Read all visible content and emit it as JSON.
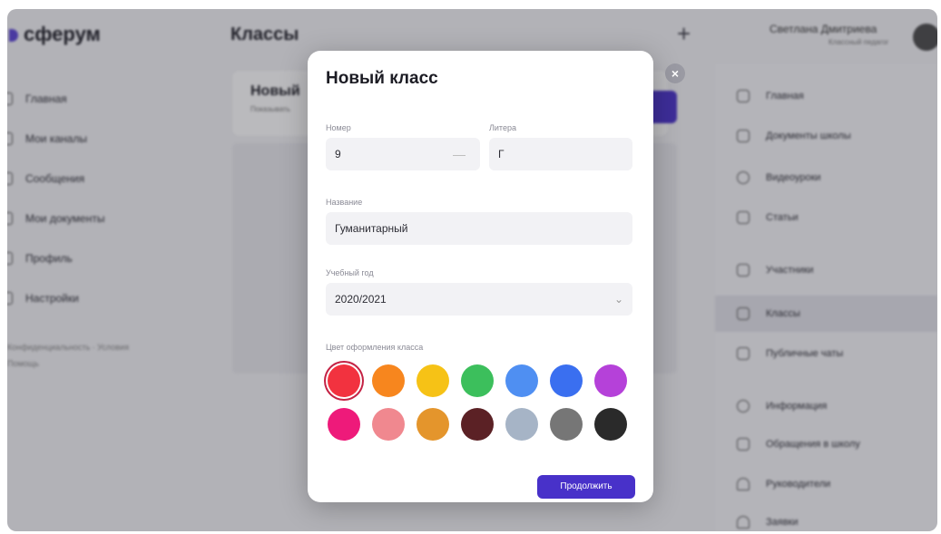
{
  "app": {
    "logo": "сферум",
    "page_title": "Классы",
    "add_icon": "plus-icon",
    "user_name": "Светлана Дмитриева",
    "user_role": "Классный педагог"
  },
  "sidebar": {
    "items": [
      {
        "label": "Главная",
        "icon": "home-icon"
      },
      {
        "label": "Мои каналы",
        "icon": "channels-icon"
      },
      {
        "label": "Сообщения",
        "icon": "chat-icon"
      },
      {
        "label": "Мои документы",
        "icon": "doc-icon"
      },
      {
        "label": "Профиль",
        "icon": "profile-icon"
      },
      {
        "label": "Настройки",
        "icon": "settings-icon"
      }
    ],
    "footer": "Конфиденциальность · Условия",
    "footer2": "Помощь"
  },
  "center": {
    "class_card_title": "Новый",
    "class_card_sub": "Показывать"
  },
  "right_panel": {
    "items": [
      {
        "label": "Главная",
        "icon": "home-icon"
      },
      {
        "label": "Документы школы",
        "icon": "document-icon"
      },
      {
        "label": "Видеоуроки",
        "icon": "play-icon"
      },
      {
        "label": "Статьи",
        "icon": "article-icon"
      },
      {
        "label": "Участники",
        "icon": "members-icon"
      },
      {
        "label": "Классы",
        "icon": "classes-icon"
      },
      {
        "label": "Публичные чаты",
        "icon": "chat-icon"
      },
      {
        "label": "Информация",
        "icon": "info-icon"
      },
      {
        "label": "Обращения в школу",
        "icon": "request-icon"
      },
      {
        "label": "Руководители",
        "icon": "leader-icon"
      },
      {
        "label": "Заявки",
        "icon": "user-add-icon"
      }
    ]
  },
  "modal": {
    "title": "Новый класс",
    "close_icon": "close-icon",
    "number_label": "Номер",
    "number_value": "9",
    "letter_label": "Литера",
    "letter_value": "Г",
    "name_label": "Название",
    "name_value": "Гуманитарный",
    "year_label": "Учебный год",
    "year_value": "2020/2021",
    "color_label": "Цвет оформления класса",
    "colors": [
      "#f2323f",
      "#f7861e",
      "#f6c216",
      "#3cbf5c",
      "#4f8ff2",
      "#3a6ff0",
      "#b541d9",
      "#ee1a7a",
      "#f0888f",
      "#e4952c",
      "#5b2125",
      "#a6b4c6",
      "#767676",
      "#2a2a2a"
    ],
    "continue_label": "Продолжить"
  }
}
